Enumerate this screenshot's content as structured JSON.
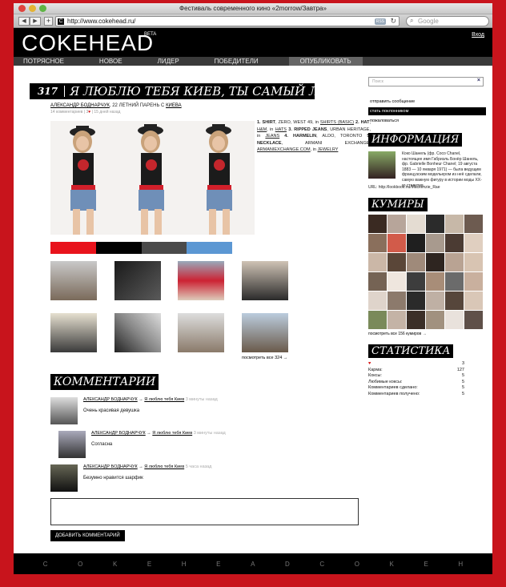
{
  "browser": {
    "window_title": "Фестиваль современного кино «2morrow/Завтра»",
    "url": "http://www.cokehead.ru/",
    "search_placeholder": "Google",
    "rss_label": "RSS"
  },
  "site": {
    "logo": "COKEHEAD",
    "beta": "BETA",
    "login": "Вход",
    "nav": [
      "ПОТРЯСНОЕ",
      "НОВОЕ",
      "ЛИДЕР",
      "ПОБЕДИТЕЛИ",
      "ОПУБЛИКОВАТЬ"
    ]
  },
  "post": {
    "number": "317",
    "title": "Я ЛЮБЛЮ ТЕБЯ КИЕВ, ТЫ САМЫЙ ЛУЧШИЙ",
    "author": "АЛЕКСАНДР БОДНАРЧУК",
    "author_desc": ", 22 ЛЕТНИЙ ПАРЕНЬ С ",
    "city": "КИЕВА",
    "comments_count": "14 комментариев",
    "likes": "3",
    "time": "15 дней назад",
    "outfit": [
      {
        "n": "1.",
        "item": "SHIRT",
        "text": ", ZERO, WEST 49, in ",
        "link": "SHIRTS (BASIC)"
      },
      {
        "n": "2.",
        "item": "HAT",
        "text": ", ",
        "link": "H&M",
        "text2": ", in ",
        "link2": "HATS"
      },
      {
        "n": "3.",
        "item": "RIPPED JEANS",
        "text": ", URBAN HERITAGE, in ",
        "link": "JEANS"
      },
      {
        "n": "4.",
        "item": "HARMELIN",
        "text": ", ALDO, TORONTO"
      },
      {
        "n": "5.",
        "item": "NECKLACE",
        "text": ", ARMANI EXCHANGE, ",
        "link": "ARMANIEXCHANGE.COM",
        "text2": ", in ",
        "link2": "JEWELRY"
      }
    ],
    "colors": [
      "#e8131c",
      "#000000",
      "#4a4a4a",
      "#5b97d3"
    ],
    "see_all": "посмотреть все 324"
  },
  "comments": {
    "heading": "КОММЕНТАРИИ",
    "items": [
      {
        "author": "АЛЕКСАНДР БОДНАРЧУК",
        "post": "Я люблю тебя Киев",
        "ago": "3 минуты назад",
        "text": "Очень красивая девушка"
      },
      {
        "author": "АЛЕКСАНДР БОДНАРЧУК",
        "post": "Я люблю тебя Киев",
        "ago": "3 минуты назад",
        "text": "Согласна"
      },
      {
        "author": "АЛЕКСАНДР БОДНАРЧУК",
        "post": "Я люблю тебя Киев",
        "ago": "5 часа назад",
        "text": "Безумно нравится шарфик"
      }
    ],
    "add_button": "ДОБАВИТЬ КОММЕНТАРИЙ"
  },
  "sidebar": {
    "search_placeholder": "Поиск",
    "links": [
      "отправить сообщение",
      "стать поклонником",
      "пожаловаться"
    ],
    "info_heading": "ИНФОРМАЦИЯ",
    "info_text": "Коко Шанель (фр. Coco Chanel, настоящее имя Габриэль Бонёр Шанель, фр. Gabrielle Bonheur Chanel; 19 августа 1883 — 10 января 1971) — была ведущим французским модельером из неё сделали, самую важную фигуру в истории моды XX-го столетия.",
    "info_url": "URL: http://lookbook.nu/Mackenzie_Rae",
    "idols_heading": "КУМИРЫ",
    "idols_link": "посмотреть все 156 кумиров",
    "stats_heading": "СТАТИСТИКА",
    "stats": [
      {
        "label": "♥",
        "value": "3"
      },
      {
        "label": "Карма:",
        "value": "127"
      },
      {
        "label": "Коксы:",
        "value": "5"
      },
      {
        "label": "Любимые коксы:",
        "value": "5"
      },
      {
        "label": "Комментариев сделано:",
        "value": "5"
      },
      {
        "label": "Комментариев получено:",
        "value": "5"
      }
    ]
  },
  "footer": {
    "letters": [
      "C",
      "O",
      "K",
      "E",
      "H",
      "E",
      "A",
      "D",
      "C",
      "O",
      "K",
      "E",
      "H"
    ]
  }
}
